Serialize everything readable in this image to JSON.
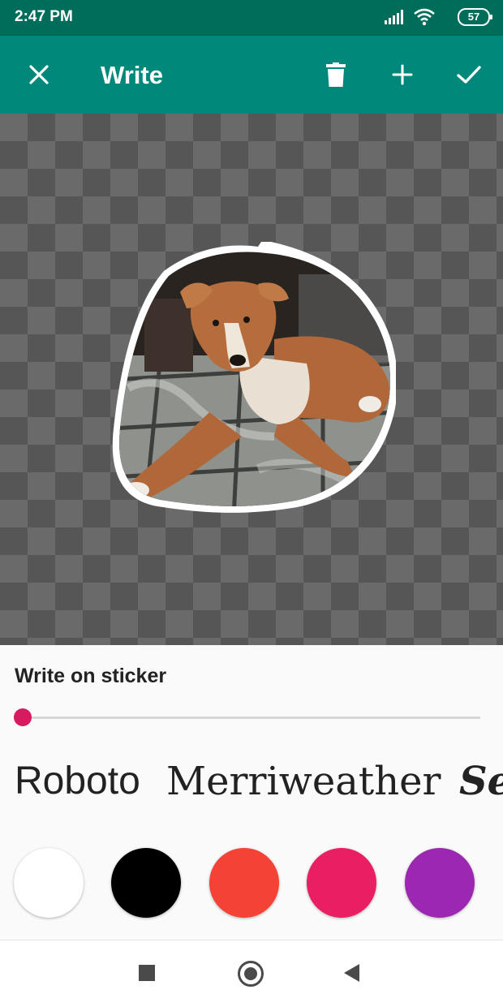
{
  "status_bar": {
    "time": "2:47 PM",
    "battery": "57",
    "icons": [
      "signal-icon",
      "wifi-icon",
      "battery-icon"
    ]
  },
  "app_bar": {
    "title": "Write",
    "actions": [
      "close-icon",
      "delete-icon",
      "add-icon",
      "check-icon"
    ],
    "color": "#00897b"
  },
  "editor": {
    "sticker": "dog-photo-sticker"
  },
  "panel": {
    "title": "Write on sticker",
    "slider_value": 0,
    "slider_color": "#d81b60",
    "fonts": [
      "Roboto",
      "Merriweather",
      "Se"
    ],
    "colors": [
      "#ffffff",
      "#000000",
      "#f44336",
      "#e91e63",
      "#9c27b0"
    ]
  },
  "nav_bar": {
    "buttons": [
      "recents-icon",
      "home-icon",
      "back-icon"
    ]
  }
}
